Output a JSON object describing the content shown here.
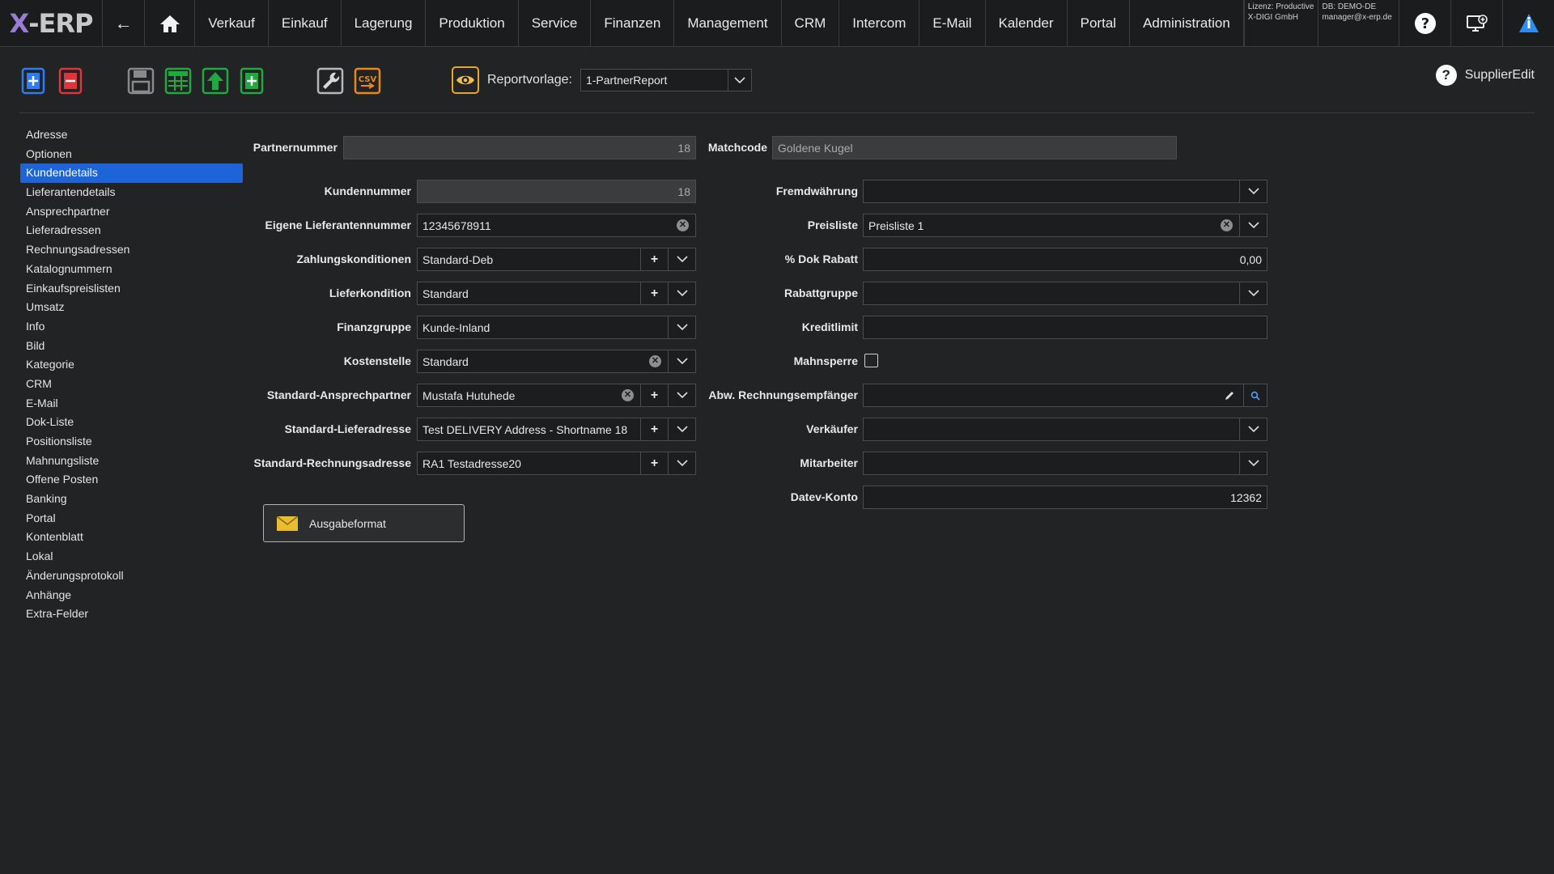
{
  "app": {
    "logo_x": "X",
    "logo_rest": "-ERP"
  },
  "nav": {
    "back": "←",
    "items": [
      "Verkauf",
      "Einkauf",
      "Lagerung",
      "Produktion",
      "Service",
      "Finanzen",
      "Management",
      "CRM",
      "Intercom",
      "E-Mail",
      "Kalender",
      "Portal",
      "Administration"
    ],
    "license_line1": "Lizenz: Productive",
    "license_line2": "X-DIGI GmbH",
    "db_line1": "DB: DEMO-DE",
    "db_line2": "manager@x-erp.de"
  },
  "toolbar": {
    "icons": [
      "new-document-icon",
      "delete-document-icon",
      "save-icon",
      "table-icon",
      "upload-icon",
      "copy-document-icon",
      "wrench-icon",
      "csv-export-icon"
    ],
    "report_label": "Reportvorlage:",
    "report_value": "1-PartnerReport",
    "help_text": "SupplierEdit"
  },
  "sidebar": {
    "items": [
      "Adresse",
      "Optionen",
      "Kundendetails",
      "Lieferantendetails",
      "Ansprechpartner",
      "Lieferadressen",
      "Rechnungsadressen",
      "Katalognummern",
      "Einkaufspreislisten",
      "Umsatz",
      "Info",
      "Bild",
      "Kategorie",
      "CRM",
      "E-Mail",
      "Dok-Liste",
      "Positionsliste",
      "Mahnungsliste",
      "Offene Posten",
      "Banking",
      "Portal",
      "Kontenblatt",
      "Lokal",
      "Änderungsprotokoll",
      "Anhänge",
      "Extra-Felder"
    ],
    "active": "Kundendetails"
  },
  "form": {
    "partnernummer": {
      "label": "Partnernummer",
      "value": "18"
    },
    "matchcode": {
      "label": "Matchcode",
      "value": "Goldene Kugel"
    },
    "kundennummer": {
      "label": "Kundennummer",
      "value": "18"
    },
    "eigene_lieferantennummer": {
      "label": "Eigene Lieferantennummer",
      "value": "12345678911"
    },
    "zahlungskonditionen": {
      "label": "Zahlungskonditionen",
      "value": "Standard-Deb"
    },
    "lieferkondition": {
      "label": "Lieferkondition",
      "value": "Standard"
    },
    "finanzgruppe": {
      "label": "Finanzgruppe",
      "value": "Kunde-Inland"
    },
    "kostenstelle": {
      "label": "Kostenstelle",
      "value": "Standard"
    },
    "standard_ansprechpartner": {
      "label": "Standard-Ansprechpartner",
      "value": "Mustafa Hutuhede"
    },
    "standard_lieferadresse": {
      "label": "Standard-Lieferadresse",
      "value": "Test DELIVERY  Address - Shortname 18"
    },
    "standard_rechnungsadresse": {
      "label": "Standard-Rechnungsadresse",
      "value": "RA1 Testadresse20"
    },
    "fremdwaehrung": {
      "label": "Fremdwährung",
      "value": ""
    },
    "preisliste": {
      "label": "Preisliste",
      "value": "Preisliste 1"
    },
    "dok_rabatt": {
      "label": "% Dok Rabatt",
      "value": "0,00"
    },
    "rabattgruppe": {
      "label": "Rabattgruppe",
      "value": ""
    },
    "kreditlimit": {
      "label": "Kreditlimit",
      "value": ""
    },
    "mahnsperre": {
      "label": "Mahnsperre",
      "checked": false
    },
    "abw_rechnungsempfaenger": {
      "label": "Abw. Rechnungsempfänger",
      "value": ""
    },
    "verkaeufer": {
      "label": "Verkäufer",
      "value": ""
    },
    "mitarbeiter": {
      "label": "Mitarbeiter",
      "value": ""
    },
    "datev_konto": {
      "label": "Datev-Konto",
      "value": "12362"
    },
    "ausgabeformat_button": "Ausgabeformat"
  },
  "colors": {
    "accent": "#1c64d8",
    "background": "#212325",
    "report_border": "#e6a82a",
    "output_button_border": "#d8b63c"
  }
}
